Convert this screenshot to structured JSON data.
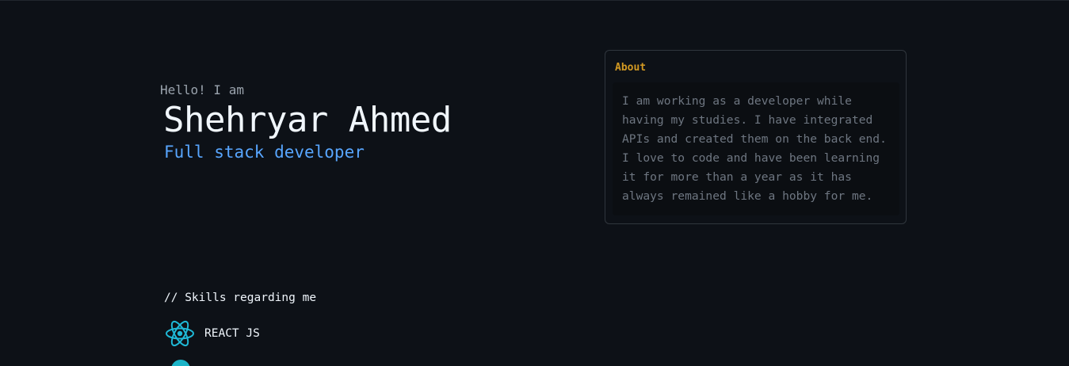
{
  "hero": {
    "greeting": "Hello! I am",
    "name": "Shehryar Ahmed",
    "role": "Full stack developer"
  },
  "about": {
    "title": "About",
    "text": "I am working as a developer while having my studies. I have integrated APIs and created them on the back end. I love to code and have been learning it for more than a year as it has always remained like a hobby for me."
  },
  "skills": {
    "heading": "// Skills regarding me",
    "items": [
      {
        "label": "REACT JS",
        "icon": "react-icon"
      },
      {
        "label": "",
        "icon": "skill-icon-partial"
      }
    ]
  },
  "colors": {
    "background": "#0d1117",
    "accent_blue": "#58a6ff",
    "about_title": "#d29922",
    "react_cyan": "#1fb8d6"
  }
}
